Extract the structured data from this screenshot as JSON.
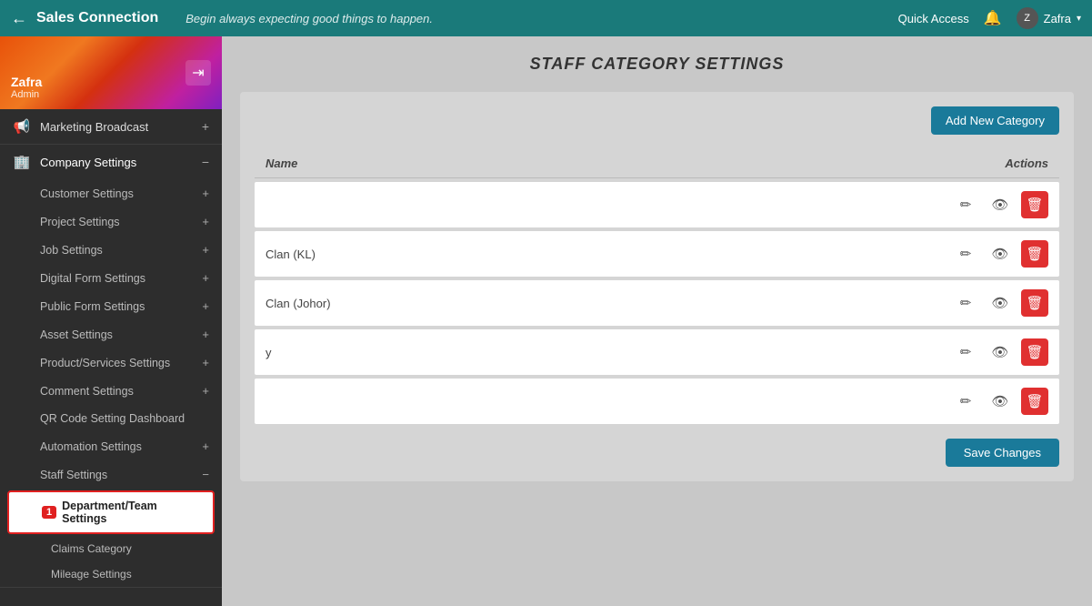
{
  "header": {
    "back_label": "←",
    "title": "Sales Connection",
    "tagline": "Begin always expecting good things to happen.",
    "quick_access_label": "Quick Access",
    "bell_label": "🔔",
    "user_name": "Zafra",
    "chevron": "▾"
  },
  "sidebar": {
    "user": {
      "name": "Zafra",
      "role": "Admin",
      "logout_icon": "⇥"
    },
    "nav": [
      {
        "id": "marketing-broadcast",
        "icon": "📢",
        "label": "Marketing Broadcast",
        "toggle": "+",
        "expanded": false
      },
      {
        "id": "company-settings",
        "icon": "🏢",
        "label": "Company Settings",
        "toggle": "−",
        "expanded": true,
        "children": [
          {
            "id": "customer-settings",
            "label": "Customer Settings",
            "toggle": "+"
          },
          {
            "id": "project-settings",
            "label": "Project Settings",
            "toggle": "+"
          },
          {
            "id": "job-settings",
            "label": "Job Settings",
            "toggle": "+"
          },
          {
            "id": "digital-form-settings",
            "label": "Digital Form Settings",
            "toggle": "+"
          },
          {
            "id": "public-form-settings",
            "label": "Public Form Settings",
            "toggle": "+"
          },
          {
            "id": "asset-settings",
            "label": "Asset Settings",
            "toggle": "+"
          },
          {
            "id": "product-services-settings",
            "label": "Product/Services Settings",
            "toggle": "+"
          },
          {
            "id": "comment-settings",
            "label": "Comment Settings",
            "toggle": "+"
          },
          {
            "id": "qr-code-setting",
            "label": "QR Code Setting Dashboard",
            "toggle": null
          },
          {
            "id": "automation-settings",
            "label": "Automation Settings",
            "toggle": "+"
          },
          {
            "id": "staff-settings",
            "label": "Staff Settings",
            "toggle": "−",
            "expanded": true,
            "children": [
              {
                "id": "department-team-settings",
                "label": "Department/Team Settings",
                "badge": "1",
                "highlighted": true
              },
              {
                "id": "claims-category",
                "label": "Claims Category"
              },
              {
                "id": "mileage-settings",
                "label": "Mileage Settings"
              }
            ]
          }
        ]
      }
    ]
  },
  "main": {
    "page_title": "STAFF CATEGORY SETTINGS",
    "add_button_label": "Add New Category",
    "table_headers": {
      "name": "Name",
      "actions": "Actions"
    },
    "rows": [
      {
        "id": "row1",
        "name": ""
      },
      {
        "id": "row2",
        "name": "Clan (KL)"
      },
      {
        "id": "row3",
        "name": "Clan (Johor)"
      },
      {
        "id": "row4",
        "name": "y"
      },
      {
        "id": "row5",
        "name": ""
      }
    ],
    "save_button_label": "Save Changes",
    "edit_icon": "✏",
    "view_icon": "👁",
    "delete_icon": "🗑"
  }
}
